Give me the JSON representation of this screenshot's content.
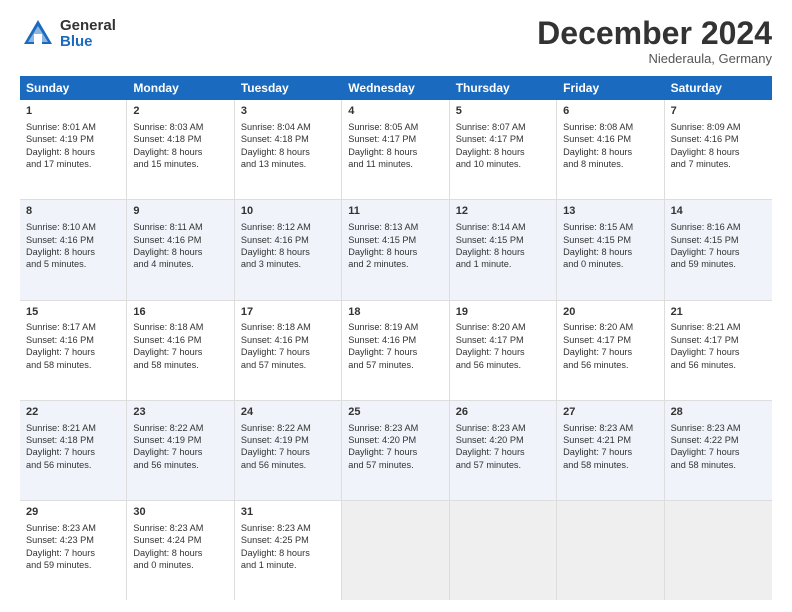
{
  "logo": {
    "general": "General",
    "blue": "Blue"
  },
  "title": "December 2024",
  "location": "Niederaula, Germany",
  "days": [
    "Sunday",
    "Monday",
    "Tuesday",
    "Wednesday",
    "Thursday",
    "Friday",
    "Saturday"
  ],
  "rows": [
    [
      {
        "day": "1",
        "lines": [
          "Sunrise: 8:01 AM",
          "Sunset: 4:19 PM",
          "Daylight: 8 hours",
          "and 17 minutes."
        ]
      },
      {
        "day": "2",
        "lines": [
          "Sunrise: 8:03 AM",
          "Sunset: 4:18 PM",
          "Daylight: 8 hours",
          "and 15 minutes."
        ]
      },
      {
        "day": "3",
        "lines": [
          "Sunrise: 8:04 AM",
          "Sunset: 4:18 PM",
          "Daylight: 8 hours",
          "and 13 minutes."
        ]
      },
      {
        "day": "4",
        "lines": [
          "Sunrise: 8:05 AM",
          "Sunset: 4:17 PM",
          "Daylight: 8 hours",
          "and 11 minutes."
        ]
      },
      {
        "day": "5",
        "lines": [
          "Sunrise: 8:07 AM",
          "Sunset: 4:17 PM",
          "Daylight: 8 hours",
          "and 10 minutes."
        ]
      },
      {
        "day": "6",
        "lines": [
          "Sunrise: 8:08 AM",
          "Sunset: 4:16 PM",
          "Daylight: 8 hours",
          "and 8 minutes."
        ]
      },
      {
        "day": "7",
        "lines": [
          "Sunrise: 8:09 AM",
          "Sunset: 4:16 PM",
          "Daylight: 8 hours",
          "and 7 minutes."
        ]
      }
    ],
    [
      {
        "day": "8",
        "lines": [
          "Sunrise: 8:10 AM",
          "Sunset: 4:16 PM",
          "Daylight: 8 hours",
          "and 5 minutes."
        ]
      },
      {
        "day": "9",
        "lines": [
          "Sunrise: 8:11 AM",
          "Sunset: 4:16 PM",
          "Daylight: 8 hours",
          "and 4 minutes."
        ]
      },
      {
        "day": "10",
        "lines": [
          "Sunrise: 8:12 AM",
          "Sunset: 4:16 PM",
          "Daylight: 8 hours",
          "and 3 minutes."
        ]
      },
      {
        "day": "11",
        "lines": [
          "Sunrise: 8:13 AM",
          "Sunset: 4:15 PM",
          "Daylight: 8 hours",
          "and 2 minutes."
        ]
      },
      {
        "day": "12",
        "lines": [
          "Sunrise: 8:14 AM",
          "Sunset: 4:15 PM",
          "Daylight: 8 hours",
          "and 1 minute."
        ]
      },
      {
        "day": "13",
        "lines": [
          "Sunrise: 8:15 AM",
          "Sunset: 4:15 PM",
          "Daylight: 8 hours",
          "and 0 minutes."
        ]
      },
      {
        "day": "14",
        "lines": [
          "Sunrise: 8:16 AM",
          "Sunset: 4:15 PM",
          "Daylight: 7 hours",
          "and 59 minutes."
        ]
      }
    ],
    [
      {
        "day": "15",
        "lines": [
          "Sunrise: 8:17 AM",
          "Sunset: 4:16 PM",
          "Daylight: 7 hours",
          "and 58 minutes."
        ]
      },
      {
        "day": "16",
        "lines": [
          "Sunrise: 8:18 AM",
          "Sunset: 4:16 PM",
          "Daylight: 7 hours",
          "and 58 minutes."
        ]
      },
      {
        "day": "17",
        "lines": [
          "Sunrise: 8:18 AM",
          "Sunset: 4:16 PM",
          "Daylight: 7 hours",
          "and 57 minutes."
        ]
      },
      {
        "day": "18",
        "lines": [
          "Sunrise: 8:19 AM",
          "Sunset: 4:16 PM",
          "Daylight: 7 hours",
          "and 57 minutes."
        ]
      },
      {
        "day": "19",
        "lines": [
          "Sunrise: 8:20 AM",
          "Sunset: 4:17 PM",
          "Daylight: 7 hours",
          "and 56 minutes."
        ]
      },
      {
        "day": "20",
        "lines": [
          "Sunrise: 8:20 AM",
          "Sunset: 4:17 PM",
          "Daylight: 7 hours",
          "and 56 minutes."
        ]
      },
      {
        "day": "21",
        "lines": [
          "Sunrise: 8:21 AM",
          "Sunset: 4:17 PM",
          "Daylight: 7 hours",
          "and 56 minutes."
        ]
      }
    ],
    [
      {
        "day": "22",
        "lines": [
          "Sunrise: 8:21 AM",
          "Sunset: 4:18 PM",
          "Daylight: 7 hours",
          "and 56 minutes."
        ]
      },
      {
        "day": "23",
        "lines": [
          "Sunrise: 8:22 AM",
          "Sunset: 4:19 PM",
          "Daylight: 7 hours",
          "and 56 minutes."
        ]
      },
      {
        "day": "24",
        "lines": [
          "Sunrise: 8:22 AM",
          "Sunset: 4:19 PM",
          "Daylight: 7 hours",
          "and 56 minutes."
        ]
      },
      {
        "day": "25",
        "lines": [
          "Sunrise: 8:23 AM",
          "Sunset: 4:20 PM",
          "Daylight: 7 hours",
          "and 57 minutes."
        ]
      },
      {
        "day": "26",
        "lines": [
          "Sunrise: 8:23 AM",
          "Sunset: 4:20 PM",
          "Daylight: 7 hours",
          "and 57 minutes."
        ]
      },
      {
        "day": "27",
        "lines": [
          "Sunrise: 8:23 AM",
          "Sunset: 4:21 PM",
          "Daylight: 7 hours",
          "and 58 minutes."
        ]
      },
      {
        "day": "28",
        "lines": [
          "Sunrise: 8:23 AM",
          "Sunset: 4:22 PM",
          "Daylight: 7 hours",
          "and 58 minutes."
        ]
      }
    ],
    [
      {
        "day": "29",
        "lines": [
          "Sunrise: 8:23 AM",
          "Sunset: 4:23 PM",
          "Daylight: 7 hours",
          "and 59 minutes."
        ]
      },
      {
        "day": "30",
        "lines": [
          "Sunrise: 8:23 AM",
          "Sunset: 4:24 PM",
          "Daylight: 8 hours",
          "and 0 minutes."
        ]
      },
      {
        "day": "31",
        "lines": [
          "Sunrise: 8:23 AM",
          "Sunset: 4:25 PM",
          "Daylight: 8 hours",
          "and 1 minute."
        ]
      },
      null,
      null,
      null,
      null
    ]
  ]
}
